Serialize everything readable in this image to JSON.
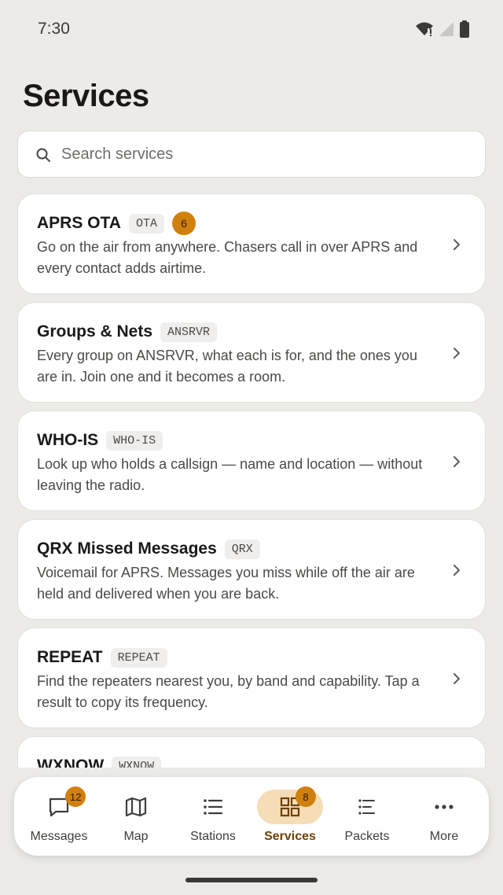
{
  "status_bar": {
    "time": "7:30"
  },
  "header": {
    "title": "Services"
  },
  "search": {
    "placeholder": "Search services"
  },
  "services": [
    {
      "title": "APRS OTA",
      "tag": "OTA",
      "badge": "6",
      "description": "Go on the air from anywhere. Chasers call in over APRS and every contact adds airtime."
    },
    {
      "title": "Groups & Nets",
      "tag": "ANSRVR",
      "description": "Every group on ANSRVR, what each is for, and the ones you are in. Join one and it becomes a room."
    },
    {
      "title": "WHO-IS",
      "tag": "WHO-IS",
      "description": "Look up who holds a callsign — name and location — without leaving the radio."
    },
    {
      "title": "QRX Missed Messages",
      "tag": "QRX",
      "description": "Voicemail for APRS. Messages you miss while off the air are held and delivered when you are back."
    },
    {
      "title": "REPEAT",
      "tag": "REPEAT",
      "description": "Find the repeaters nearest you, by band and capability. Tap a result to copy its frequency."
    },
    {
      "title": "WXNOW",
      "tag": "WXNOW",
      "description": ""
    }
  ],
  "bottom_nav": {
    "items": [
      {
        "label": "Messages",
        "icon": "message-icon",
        "badge": "12"
      },
      {
        "label": "Map",
        "icon": "map-icon"
      },
      {
        "label": "Stations",
        "icon": "list-icon"
      },
      {
        "label": "Services",
        "icon": "grid-icon",
        "badge": "8",
        "active": true
      },
      {
        "label": "Packets",
        "icon": "packets-icon"
      },
      {
        "label": "More",
        "icon": "more-icon"
      }
    ]
  },
  "colors": {
    "accent": "#d0800e",
    "active_pill": "#f6ddb7",
    "background": "#ecebe8"
  }
}
